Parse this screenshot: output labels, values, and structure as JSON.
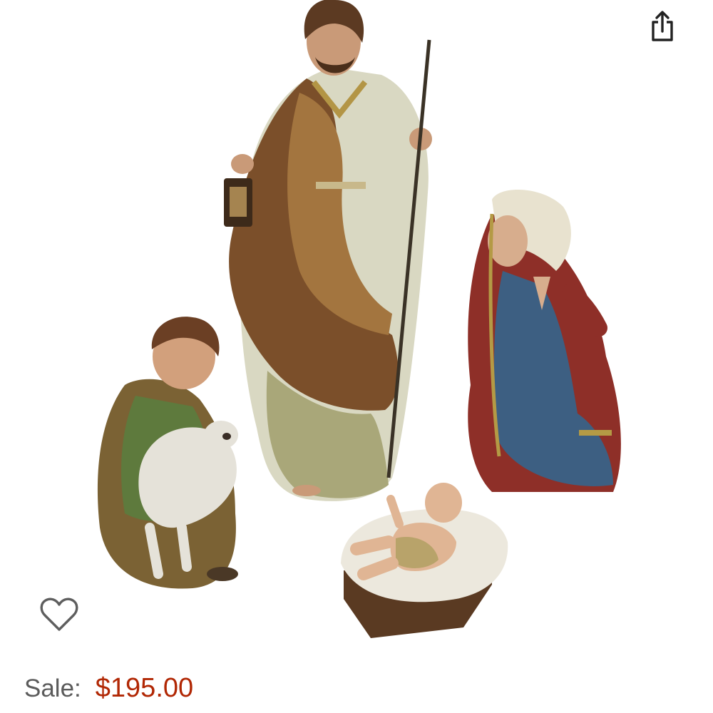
{
  "header": {
    "share_icon": "share-icon"
  },
  "product": {
    "image_icon": "nativity-figurine-set",
    "favorite_icon": "heart-outline-icon",
    "sale_label": "Sale:",
    "sale_price": "$195.00"
  },
  "colors": {
    "price": "#b12704",
    "label": "#5b5b5b",
    "icon": "#222222"
  }
}
